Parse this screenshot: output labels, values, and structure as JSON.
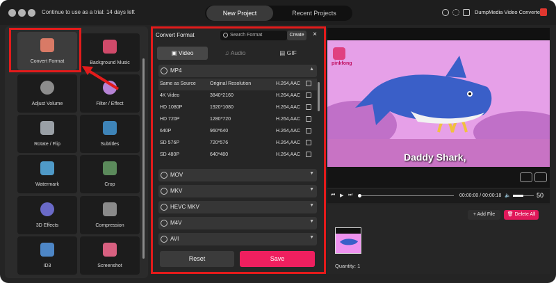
{
  "titlebar": {
    "trial_text": "Continue to use as a trial: 14 days left",
    "tabs": [
      {
        "label": "New Project",
        "active": true
      },
      {
        "label": "Recent Projects",
        "active": false
      }
    ],
    "icons": [
      "user-icon",
      "gear-icon"
    ],
    "brand": "DumpMedia Video Converter"
  },
  "tools": [
    {
      "label": "Convert Format",
      "icon": "convert-format-icon",
      "selected": true
    },
    {
      "label": "Background Music",
      "icon": "music-icon",
      "selected": false
    },
    {
      "label": "Adjust Volume",
      "icon": "volume-icon",
      "selected": false
    },
    {
      "label": "Filter / Effect",
      "icon": "filter-icon",
      "selected": false
    },
    {
      "label": "Rotate / Flip",
      "icon": "rotate-icon",
      "selected": false
    },
    {
      "label": "Subtitles",
      "icon": "subtitles-icon",
      "selected": false
    },
    {
      "label": "Watermark",
      "icon": "watermark-icon",
      "selected": false
    },
    {
      "label": "Crop",
      "icon": "crop-icon",
      "selected": false
    },
    {
      "label": "3D Effects",
      "icon": "3d-glasses-icon",
      "selected": false
    },
    {
      "label": "Compression",
      "icon": "compression-icon",
      "selected": false
    },
    {
      "label": "ID3",
      "icon": "id3-icon",
      "selected": false
    },
    {
      "label": "Screenshot",
      "icon": "screenshot-icon",
      "selected": false
    }
  ],
  "convert_panel": {
    "title": "Convert Format",
    "search_placeholder": "Search Format",
    "create_label": "Create",
    "close_label": "×",
    "media_tabs": [
      {
        "label": "Video",
        "icon": "film-icon",
        "active": true
      },
      {
        "label": "Audio",
        "icon": "music-note-icon",
        "active": false
      },
      {
        "label": "GIF",
        "icon": "gif-icon",
        "active": false
      }
    ],
    "expanded_group": {
      "name": "MP4",
      "chevron": "▲"
    },
    "formats": [
      {
        "name": "Same as Source",
        "resolution": "Original Resolution",
        "codec": "H.264,AAC",
        "selected": true
      },
      {
        "name": "4K Video",
        "resolution": "3840*2160",
        "codec": "H.264,AAC",
        "selected": false
      },
      {
        "name": "HD 1080P",
        "resolution": "1920*1080",
        "codec": "H.264,AAC",
        "selected": false
      },
      {
        "name": "HD 720P",
        "resolution": "1280*720",
        "codec": "H.264,AAC",
        "selected": false
      },
      {
        "name": "640P",
        "resolution": "960*640",
        "codec": "H.264,AAC",
        "selected": false
      },
      {
        "name": "SD 576P",
        "resolution": "720*576",
        "codec": "H.264,AAC",
        "selected": false
      },
      {
        "name": "SD 480P",
        "resolution": "640*480",
        "codec": "H.264,AAC",
        "selected": false
      }
    ],
    "collapsed_groups": [
      {
        "name": "MOV",
        "chevron": "▼"
      },
      {
        "name": "MKV",
        "chevron": "▼"
      },
      {
        "name": "HEVC MKV",
        "chevron": "▼"
      },
      {
        "name": "M4V",
        "chevron": "▼"
      },
      {
        "name": "AVI",
        "chevron": "▼"
      }
    ],
    "reset_label": "Reset",
    "save_label": "Save"
  },
  "preview": {
    "logo_text": "pinkfong",
    "subtitle": "Daddy Shark,",
    "time": "00:00:00 / 00:00:18",
    "volume": "50",
    "volume_level": 0.5,
    "icons": [
      "camera-icon",
      "window-icon",
      "skip-back-icon",
      "play-icon",
      "skip-forward-icon",
      "speaker-icon"
    ]
  },
  "files": {
    "add_label": "+ Add File",
    "delete_label": "Delete All",
    "quantity": "Quantity: 1"
  },
  "colors": {
    "accent": "#ef1f5f",
    "highlight": "#e31b1b"
  }
}
